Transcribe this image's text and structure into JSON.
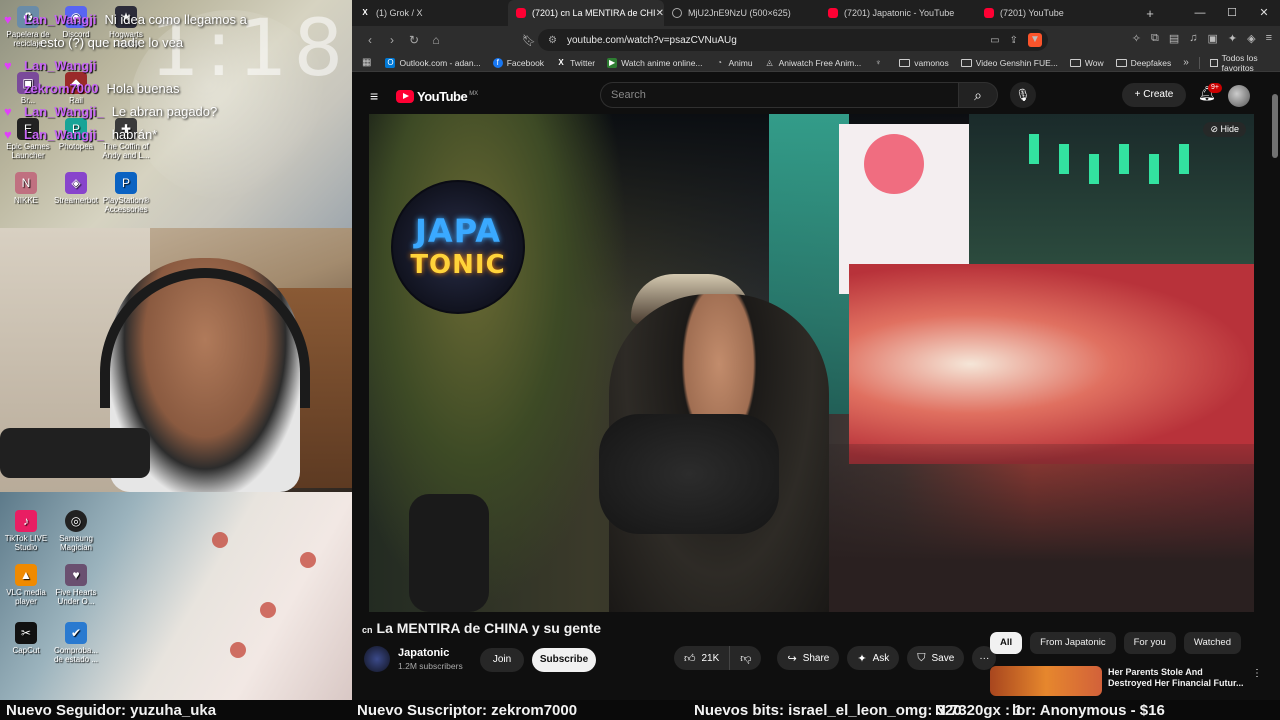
{
  "stream": {
    "clock_text": "1:18",
    "chat": [
      {
        "user": "Lan_Wangji",
        "message": "Ni idea como llegamos a"
      },
      {
        "user": "",
        "message": "esto (?) que nadie lo vea"
      },
      {
        "user": "Lan_Wangji",
        "message": ""
      },
      {
        "user": "zekrom7000",
        "message": "Hola buenas"
      },
      {
        "user": "Lan_Wangji_",
        "message": "Le abran pagado?"
      },
      {
        "user": "Lan_Wangji_",
        "message": "habrán*"
      }
    ],
    "desktop_icons_top": [
      {
        "label": "Papelera de reciclaje",
        "icon": "recycle-bin-icon"
      },
      {
        "label": "Discord",
        "icon": "discord-icon"
      },
      {
        "label": "Hogwarts Legacy",
        "icon": "game-icon"
      },
      {
        "label": "Br...",
        "icon": "app-icon"
      },
      {
        "label": "Rail",
        "icon": "game-icon"
      },
      {
        "label": "Epic Games Launcher",
        "icon": "epic-icon"
      },
      {
        "label": "Photopea",
        "icon": "photopea-icon"
      },
      {
        "label": "The Coffin of Andy and L...",
        "icon": "game-icon"
      },
      {
        "label": "NIKKE",
        "icon": "game-icon"
      },
      {
        "label": "Streamerbot",
        "icon": "bot-icon"
      },
      {
        "label": "PlayStation® Accessories",
        "icon": "playstation-icon"
      }
    ],
    "desktop_icons_bottom": [
      {
        "label": "TikTok LIVE Studio",
        "icon": "tiktok-icon"
      },
      {
        "label": "Samsung Magician",
        "icon": "magician-icon"
      },
      {
        "label": "VLC media player",
        "icon": "vlc-icon"
      },
      {
        "label": "Five Hearts Under O...",
        "icon": "game-icon"
      },
      {
        "label": "CapCut",
        "icon": "capcut-icon"
      },
      {
        "label": "Comproba... de estado ...",
        "icon": "status-icon"
      }
    ],
    "ticker": {
      "follower": "Nuevo Seguidor: yuzuha_uka",
      "subscriber": "Nuevo Suscriptor: zekrom7000",
      "bits": "Nuevos bits: israel_el_leon_omg: 320",
      "overlap": "N 7320gx : 1",
      "donor": "lor: Anonymous - $16"
    }
  },
  "browser": {
    "tabs": [
      {
        "title": "(1) Grok / X",
        "icon": "x-icon",
        "active": false
      },
      {
        "title": "(7201) cn La MENTIRA de CHI",
        "icon": "youtube-icon",
        "active": true
      },
      {
        "title": "MjU2JnE9NzU (500×625)",
        "icon": "globe-icon",
        "active": false
      },
      {
        "title": "(7201) Japatonic - YouTube",
        "icon": "youtube-icon",
        "active": false
      },
      {
        "title": "(7201) YouTube",
        "icon": "youtube-icon",
        "active": false
      }
    ],
    "new_tab": "+",
    "url": "youtube.com/watch?v=psazCVNuAUg",
    "bookmarks": [
      {
        "label": "Outlook.com - adan...",
        "icon": "outlook-icon"
      },
      {
        "label": "Facebook",
        "icon": "facebook-icon"
      },
      {
        "label": "Twitter",
        "icon": "x-icon"
      },
      {
        "label": "Watch anime online...",
        "icon": "anime-icon"
      },
      {
        "label": "Animu",
        "icon": "animu-icon"
      },
      {
        "label": "Aniwatch Free Anim...",
        "icon": "aniwatch-icon"
      },
      {
        "label": "",
        "icon": "leaf-icon"
      },
      {
        "label": "vamonos",
        "icon": "folder-icon"
      },
      {
        "label": "Video Genshin FUE...",
        "icon": "folder-icon"
      },
      {
        "label": "Wow",
        "icon": "folder-icon"
      },
      {
        "label": "Deepfakes",
        "icon": "folder-icon"
      }
    ],
    "all_bookmarks": "Todos los favoritos"
  },
  "youtube": {
    "logo": "YouTube",
    "country": "MX",
    "search_placeholder": "Search",
    "create_label": "Create",
    "notifications": "9+",
    "hide_label": "Hide",
    "video_logo_line1": "JAPA",
    "video_logo_line2": "TONIC",
    "video_title_prefix": "cn",
    "video_title": "La MENTIRA de CHINA y su gente",
    "channel_name": "Japatonic",
    "subscribers": "1.2M subscribers",
    "join_label": "Join",
    "subscribe_label": "Subscribe",
    "likes": "21K",
    "share_label": "Share",
    "ask_label": "Ask",
    "save_label": "Save",
    "chips": [
      {
        "label": "All",
        "active": true
      },
      {
        "label": "From Japatonic",
        "active": false
      },
      {
        "label": "For you",
        "active": false
      },
      {
        "label": "Watched",
        "active": false
      }
    ],
    "recommendation_title": "Her Parents Stole And Destroyed Her Financial Futur..."
  }
}
